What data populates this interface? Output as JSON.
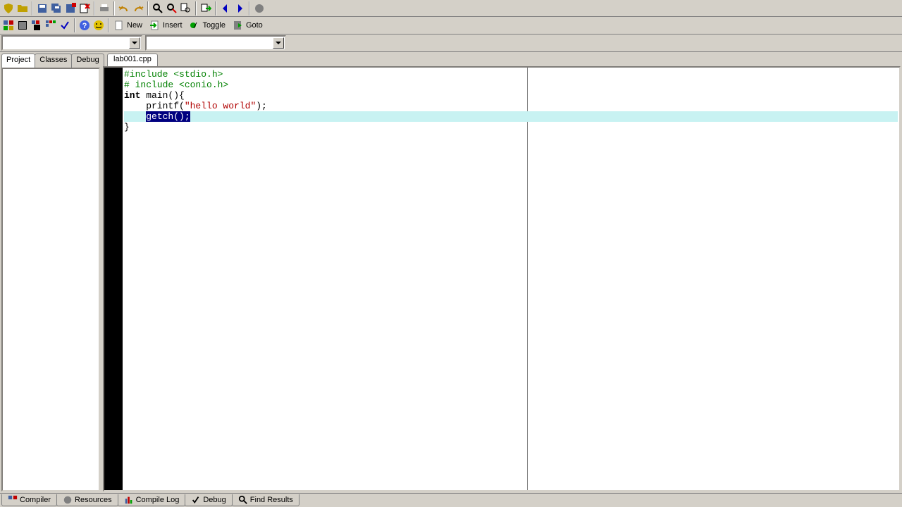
{
  "toolbar1": {
    "icons": [
      "shield",
      "folder",
      "disk",
      "disks",
      "disk-red",
      "close-file",
      "printer",
      "undo",
      "redo",
      "find",
      "replace",
      "find-files",
      "help-back",
      "step-in",
      "step-out",
      "stop-debug"
    ]
  },
  "toolbar2": {
    "btn_new": "New",
    "btn_insert": "Insert",
    "btn_toggle": "Toggle",
    "btn_goto": "Goto"
  },
  "side_tabs": [
    "Project",
    "Classes",
    "Debug"
  ],
  "file_tab": "lab001.cpp",
  "code": {
    "l1a": "#include ",
    "l1b": "<stdio.h>",
    "l2a": "# include ",
    "l2b": "<conio.h>",
    "l3a": "int",
    "l3b": " main(){",
    "l4a": "    printf(",
    "l4b": "\"hello world\"",
    "l4c": ");",
    "l5indent": "    ",
    "l5sel": "getch();",
    "l6": "}"
  },
  "bottom_tabs": [
    "Compiler",
    "Resources",
    "Compile Log",
    "Debug",
    "Find Results"
  ]
}
